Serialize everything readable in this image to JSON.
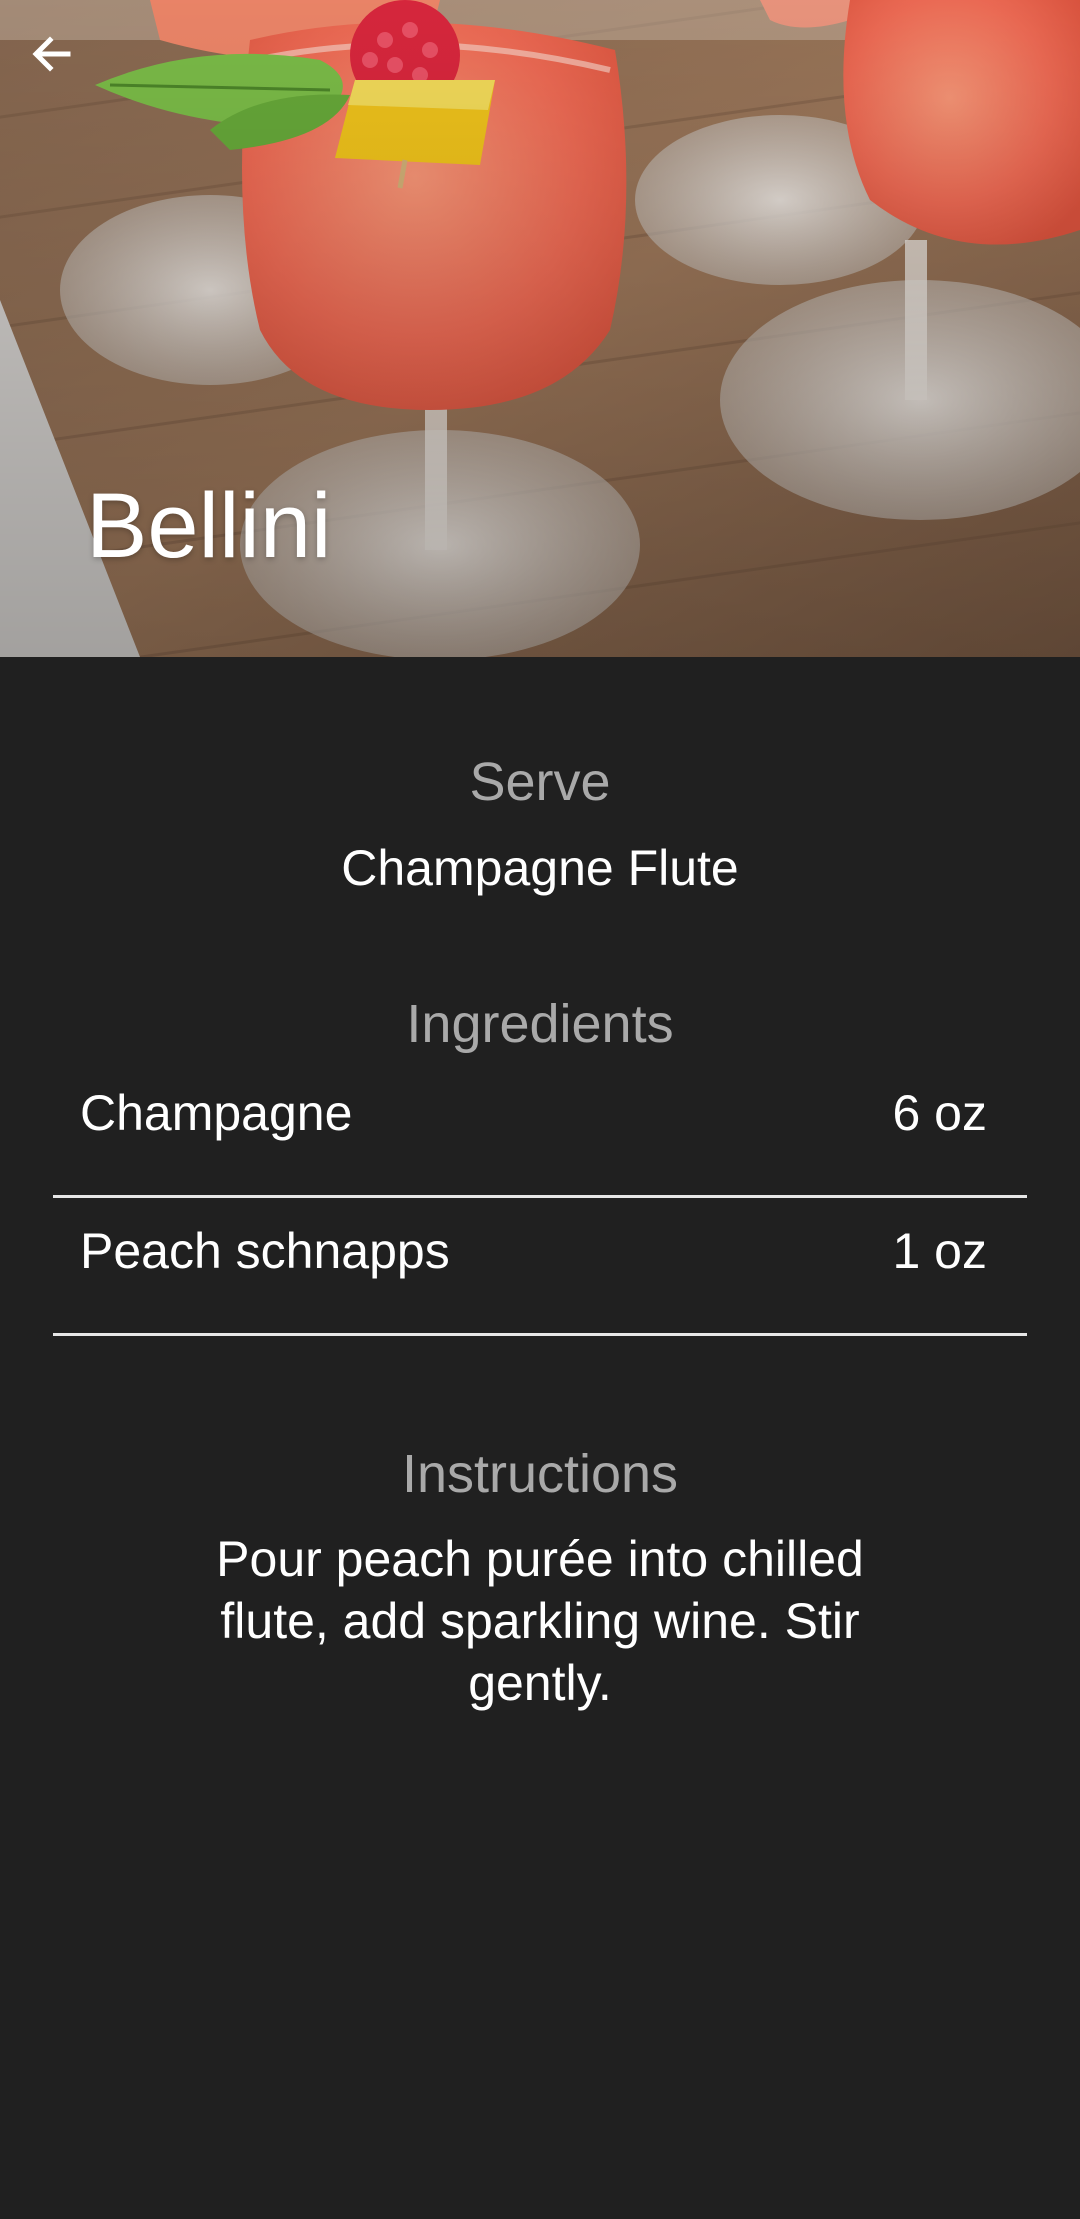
{
  "drink": {
    "name": "Bellini"
  },
  "serve": {
    "heading": "Serve",
    "glass": "Champagne Flute"
  },
  "ingredients": {
    "heading": "Ingredients",
    "items": [
      {
        "name": "Champagne",
        "amount": "6 oz"
      },
      {
        "name": "Peach schnapps",
        "amount": "1 oz"
      }
    ]
  },
  "instructions": {
    "heading": "Instructions",
    "text": "Pour peach purée into chilled flute, add sparkling wine. Stir gently."
  },
  "icons": {
    "back": "arrow-left-icon"
  },
  "colors": {
    "background": "#202020",
    "heading": "#a9a9a9",
    "text": "#ffffff",
    "divider": "#e6e6e6"
  }
}
